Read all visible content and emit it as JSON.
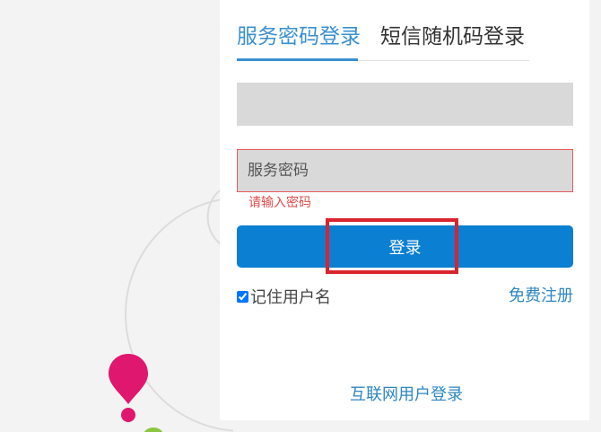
{
  "tabs": {
    "active_label": "服务密码登录",
    "inactive_label": "短信随机码登录"
  },
  "form": {
    "username_value": "",
    "password_placeholder": "服务密码",
    "password_error": "请输入密码",
    "login_label": "登录",
    "remember_label": "记住用户名",
    "remember_checked": true
  },
  "links": {
    "register": "免费注册",
    "internet_login": "互联网用户登录"
  },
  "colors": {
    "accent": "#3a8fcf",
    "button": "#0b7fd2",
    "error": "#e24b4b",
    "highlight": "#d9232d",
    "pin_magenta": "#e0176e",
    "pin_green": "#8cc63f"
  },
  "icons": {
    "location_pin": "map-pin-icon",
    "check": "checkbox-checked"
  }
}
